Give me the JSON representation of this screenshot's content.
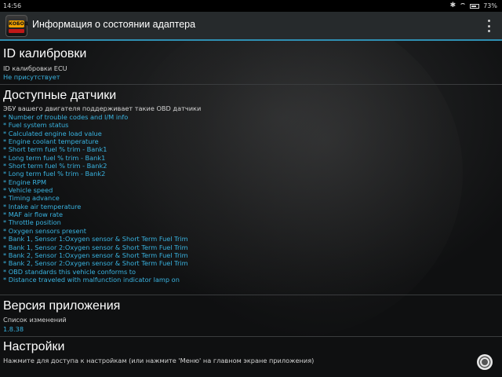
{
  "status_bar": {
    "time": "14:56",
    "battery": "73%"
  },
  "action_bar": {
    "app_logo_text": "КОБОД",
    "title": "Информация о состоянии адаптера"
  },
  "calibration": {
    "title": "ID калибровки",
    "label": "ID калибровки ECU",
    "value": "Не присутствует"
  },
  "sensors": {
    "title": "Доступные датчики",
    "description": "ЭБУ вашего двигателя поддерживает такие OBD датчики",
    "items": [
      "* Number of trouble codes and I/M info",
      "* Fuel system status",
      "* Calculated engine load value",
      "* Engine coolant temperature",
      "* Short term fuel % trim - Bank1",
      "* Long term fuel % trim - Bank1",
      "* Short term fuel % trim - Bank2",
      "* Long term fuel % trim - Bank2",
      "* Engine RPM",
      "* Vehicle speed",
      "* Timing advance",
      "* Intake air temperature",
      "* MAF air flow rate",
      "* Throttle position",
      "* Oxygen sensors present",
      "* Bank 1, Sensor 1:Oxygen sensor & Short Term Fuel Trim",
      "* Bank 1, Sensor 2:Oxygen sensor & Short Term Fuel Trim",
      "* Bank 2, Sensor 1:Oxygen sensor & Short Term Fuel Trim",
      "* Bank 2, Sensor 2:Oxygen sensor & Short Term Fuel Trim",
      "* OBD standards this vehicle conforms to",
      "* Distance traveled with malfunction indicator lamp on"
    ]
  },
  "app_version": {
    "title": "Версия приложения",
    "label": "Список изменений",
    "value": "1.8.38"
  },
  "settings": {
    "title": "Настройки",
    "label": "Нажмите для доступа к настройкам (или нажмите 'Меню' на главном экране приложения)"
  },
  "colors": {
    "accent": "#39b3e0",
    "action_bar": "#262a2c",
    "divider_accent": "#2f8fb2"
  },
  "icons": {
    "overflow": "overflow-menu-icon",
    "bluetooth": "bluetooth-icon",
    "wifi": "wifi-icon",
    "battery": "battery-icon",
    "settings": "gear-icon"
  }
}
